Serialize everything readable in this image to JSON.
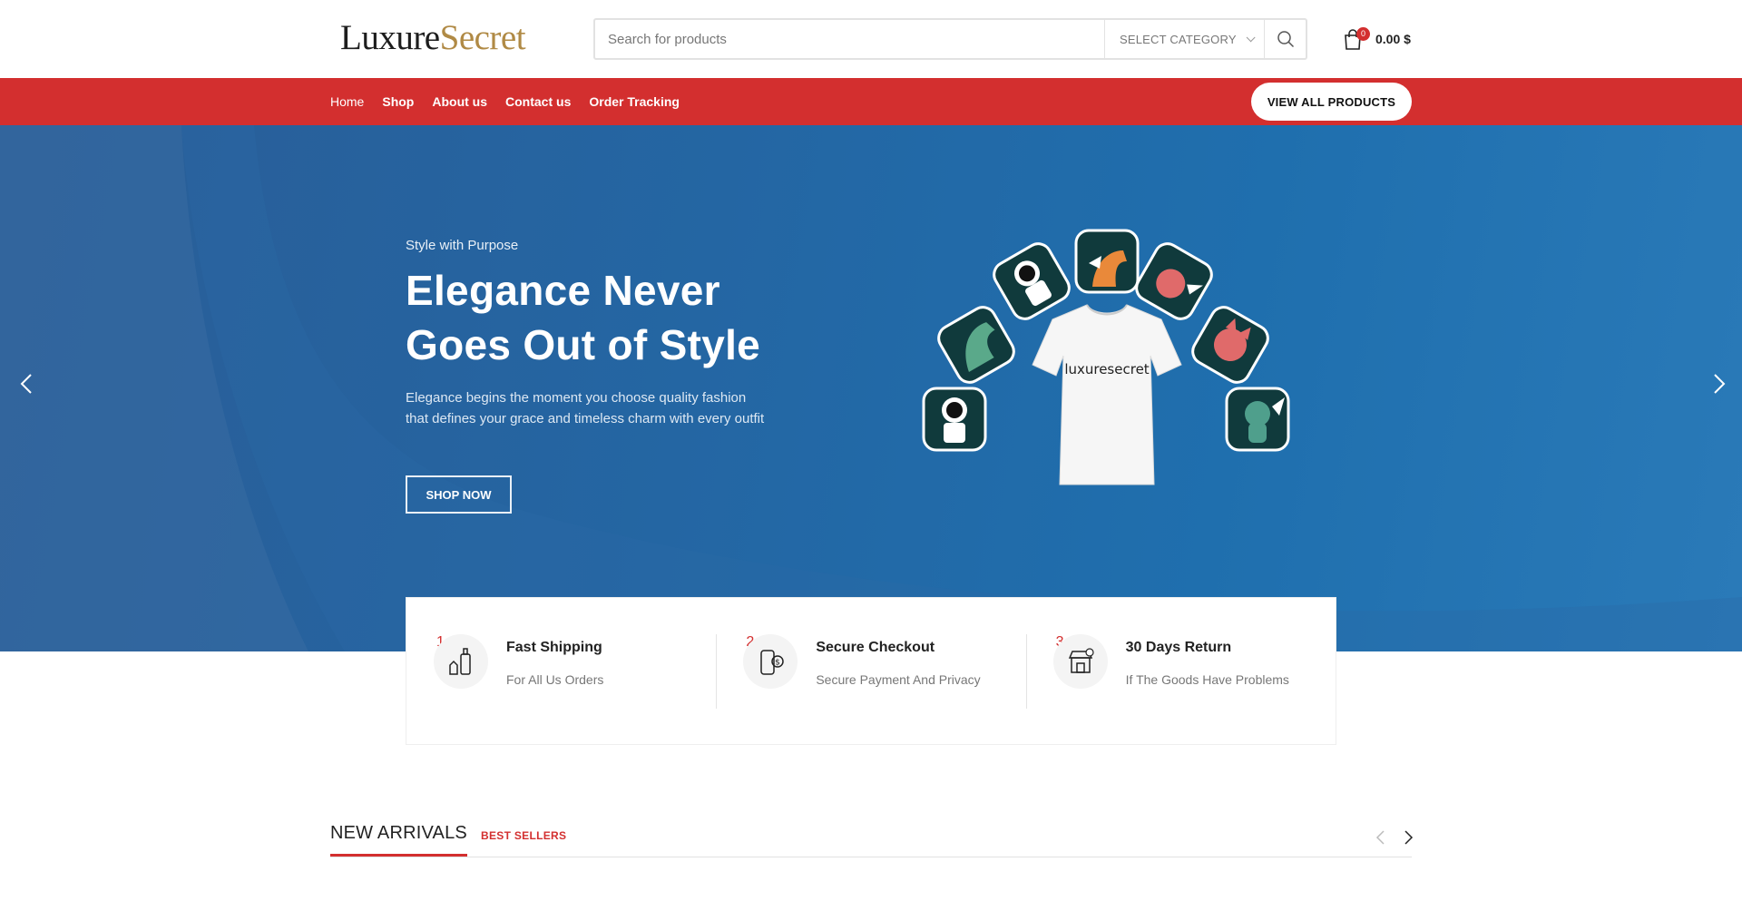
{
  "header": {
    "logo_part1": "Luxure",
    "logo_part2": "Secret",
    "search_placeholder": "Search for products",
    "category_select": "SELECT CATEGORY",
    "cart_count": "0",
    "cart_total": "0.00 $"
  },
  "nav": {
    "items": [
      "Home",
      "Shop",
      "About us",
      "Contact us",
      "Order Tracking"
    ],
    "cta": "VIEW ALL PRODUCTS",
    "color": "#d32f2f"
  },
  "hero": {
    "subtitle": "Style with Purpose",
    "title": "Elegance Never Goes Out of Style",
    "description": "Elegance begins the moment you choose quality fashion that defines your grace and timeless charm with every outfit",
    "button": "SHOP NOW",
    "tshirt_text": "luxuresecret"
  },
  "features": [
    {
      "num": "1.",
      "title": "Fast Shipping",
      "desc": "For All Us Orders",
      "icon": "shipping-icon"
    },
    {
      "num": "2.",
      "title": "Secure Checkout",
      "desc": "Secure Payment And Privacy",
      "icon": "secure-payment-icon"
    },
    {
      "num": "3.",
      "title": "30 Days Return",
      "desc": "If The Goods Have Problems",
      "icon": "store-return-icon"
    }
  ],
  "tabs": {
    "active": "NEW ARRIVALS",
    "other": "BEST SELLERS"
  }
}
